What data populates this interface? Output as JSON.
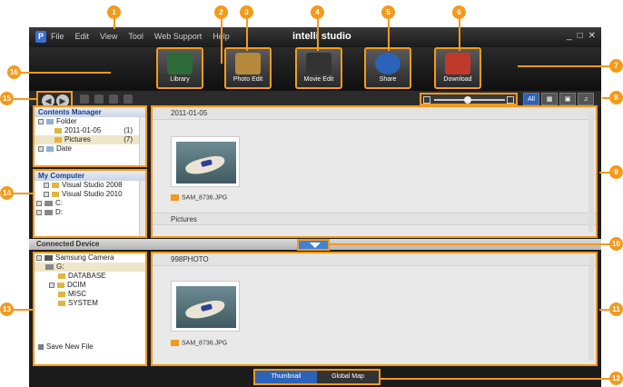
{
  "app": {
    "title": "intelli studio",
    "menu": [
      "File",
      "Edit",
      "View",
      "Tool",
      "Web Support",
      "Help"
    ]
  },
  "toolbar": {
    "items": [
      {
        "label": "Library",
        "icon": "library-icon",
        "color": "#2e6b3a"
      },
      {
        "label": "Photo Edit",
        "icon": "photo-edit-icon",
        "color": "#b58a3c"
      },
      {
        "label": "Movie Edit",
        "icon": "movie-edit-icon",
        "color": "#333333"
      },
      {
        "label": "Share",
        "icon": "share-globe-icon",
        "color": "#2c63b8"
      },
      {
        "label": "Download",
        "icon": "download-icon",
        "color": "#c03a2c"
      }
    ]
  },
  "view": {
    "buttons": [
      "All",
      "",
      "",
      ""
    ],
    "zoom_level": 0.48
  },
  "contents_manager": {
    "title": "Contents Manager",
    "rows": [
      {
        "label": "Folder",
        "count": ""
      },
      {
        "label": "2011-01-05",
        "count": "(1)"
      },
      {
        "label": "Pictures",
        "count": "(7)"
      },
      {
        "label": "Date",
        "count": ""
      }
    ]
  },
  "my_computer": {
    "title": "My Computer",
    "rows": [
      "Visual Studio 2008",
      "Visual Studio 2010",
      "C:",
      "D:"
    ]
  },
  "connected": {
    "title": "Connected Device",
    "rows": [
      "Samsung Camera",
      "G:",
      "DATABASE",
      "DCIM",
      "MISC",
      "SYSTEM"
    ],
    "save_label": "Save New File"
  },
  "main": {
    "section1": "2011-01-05",
    "file1": "SAM_8736.JPG",
    "section2": "Pictures",
    "section3": "998PHOTO",
    "file2": "SAM_8736.JPG"
  },
  "status": {
    "thumbnail": "Thumbnail",
    "global_map": "Global Map"
  },
  "callouts": [
    "1",
    "2",
    "3",
    "4",
    "5",
    "6",
    "7",
    "8",
    "9",
    "10",
    "11",
    "12",
    "13",
    "14",
    "15",
    "16"
  ],
  "colors": {
    "accent": "#f39a1c",
    "selected": "#2c63b8"
  }
}
